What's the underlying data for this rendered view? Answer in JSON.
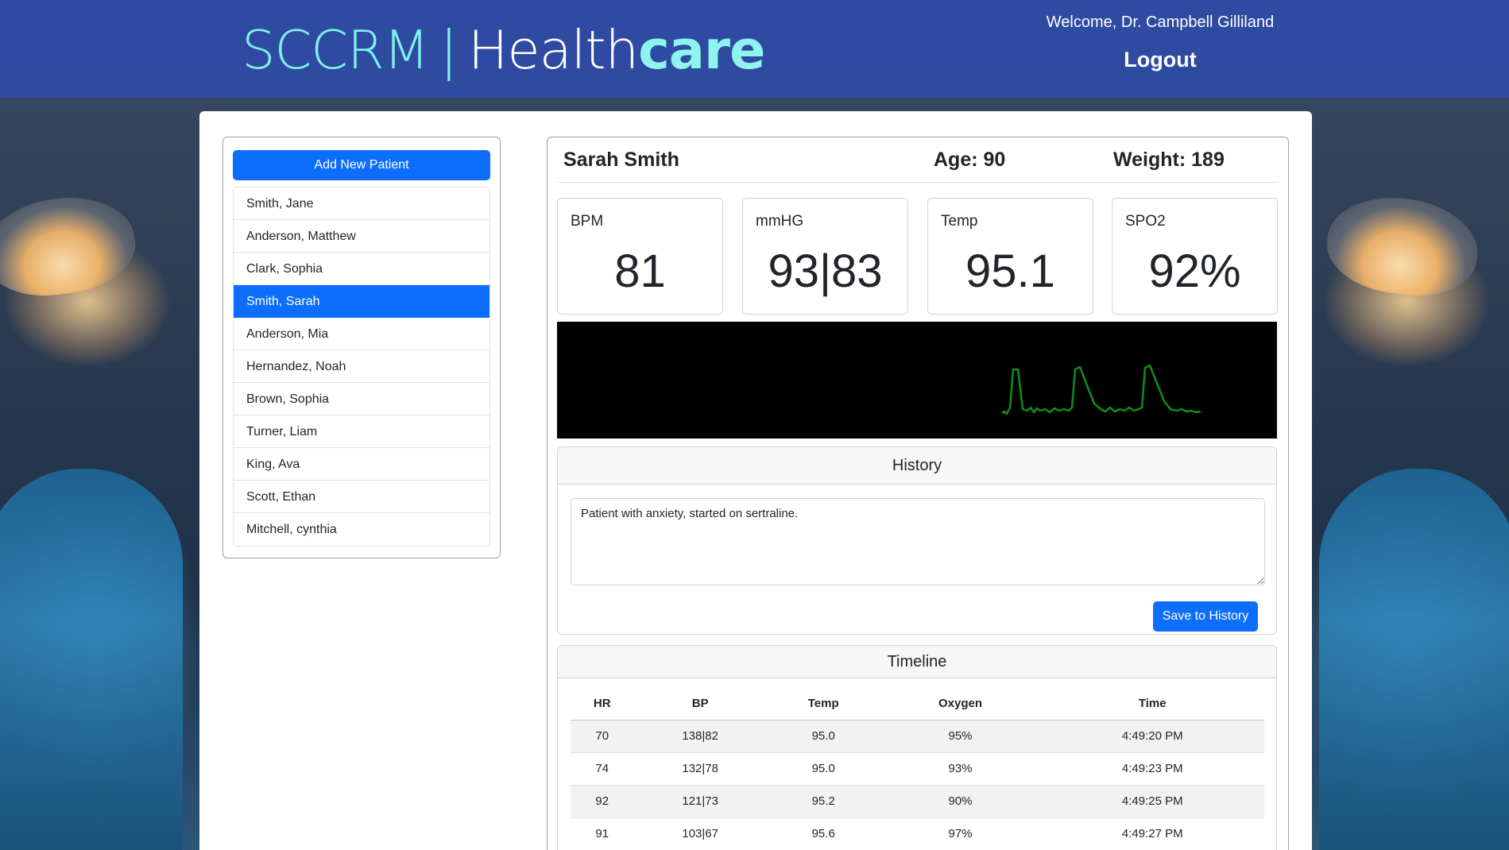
{
  "header": {
    "brand_part1": "SCCRM",
    "brand_sep": "|",
    "brand_part2": "Health",
    "brand_part3": "care",
    "welcome": "Welcome, Dr. Campbell Gilliland",
    "logout_label": "Logout"
  },
  "sidebar": {
    "add_label": "Add New Patient",
    "patients": [
      "Smith, Jane",
      "Anderson, Matthew",
      "Clark, Sophia",
      "Smith, Sarah",
      "Anderson, Mia",
      "Hernandez, Noah",
      "Brown, Sophia",
      "Turner, Liam",
      "King, Ava",
      "Scott, Ethan",
      "Mitchell, cynthia"
    ],
    "selected_index": 3
  },
  "patient": {
    "name": "Sarah Smith",
    "age_label": "Age: 90",
    "weight_label": "Weight: 189"
  },
  "vitals": [
    {
      "label": "BPM",
      "value": "81"
    },
    {
      "label": "mmHG",
      "value": "93|83"
    },
    {
      "label": "Temp",
      "value": "95.1"
    },
    {
      "label": "SPO2",
      "value": "92%"
    }
  ],
  "monitor": {
    "trace_color": "#0b8f1a"
  },
  "history": {
    "title": "History",
    "note": "Patient with anxiety, started on sertraline.",
    "save_label": "Save to History"
  },
  "timeline": {
    "title": "Timeline",
    "columns": [
      "HR",
      "BP",
      "Temp",
      "Oxygen",
      "Time"
    ],
    "rows": [
      [
        "70",
        "138|82",
        "95.0",
        "95%",
        "4:49:20 PM"
      ],
      [
        "74",
        "132|78",
        "95.0",
        "93%",
        "4:49:23 PM"
      ],
      [
        "92",
        "121|73",
        "95.2",
        "90%",
        "4:49:25 PM"
      ],
      [
        "91",
        "103|67",
        "95.6",
        "97%",
        "4:49:27 PM"
      ]
    ]
  },
  "colors": {
    "header_bg": "#2d4baa",
    "accent": "#0d6efd",
    "brand_teal": "#7ff0ec"
  }
}
